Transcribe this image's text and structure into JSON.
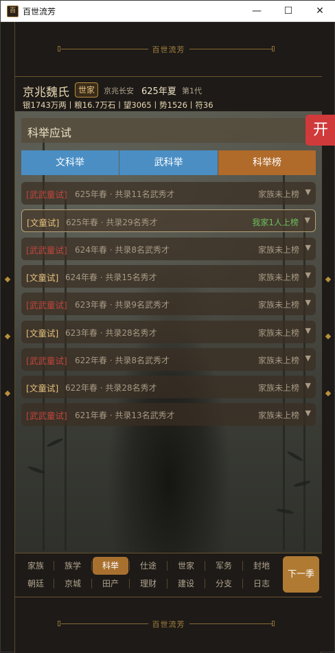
{
  "window": {
    "title": "百世流芳",
    "icon": "app-seal-icon",
    "icon_glyph": "百",
    "minimize": "—",
    "maximize": "☐",
    "close": "✕"
  },
  "banner": {
    "text": "百世流芳"
  },
  "family": {
    "name": "京兆魏氏",
    "badge": "世家",
    "place": "京兆长安",
    "year": "625年夏",
    "generation": "第1代",
    "stats": "银1743万两丨粮16.7万石丨望3065丨势1526丨符36"
  },
  "panel": {
    "title": "科举应试",
    "tabs": [
      "文科举",
      "武科举",
      "科举榜"
    ],
    "active_tab": 2,
    "results": [
      {
        "exam": "[武武童试]",
        "kind": "wu",
        "info": "625年春 · 共录11名武秀才",
        "status": "家族未上榜",
        "highlight": false
      },
      {
        "exam": "[文童试]",
        "kind": "wen",
        "info": "625年春 · 共录29名秀才",
        "status": "我家1人上榜",
        "highlight": true
      },
      {
        "exam": "[武武童试]",
        "kind": "wu",
        "info": "624年春 · 共录8名武秀才",
        "status": "家族未上榜",
        "highlight": false
      },
      {
        "exam": "[文童试]",
        "kind": "wen",
        "info": "624年春 · 共录15名秀才",
        "status": "家族未上榜",
        "highlight": false
      },
      {
        "exam": "[武武童试]",
        "kind": "wu",
        "info": "623年春 · 共录9名武秀才",
        "status": "家族未上榜",
        "highlight": false
      },
      {
        "exam": "[文童试]",
        "kind": "wen",
        "info": "623年春 · 共录28名秀才",
        "status": "家族未上榜",
        "highlight": false
      },
      {
        "exam": "[武武童试]",
        "kind": "wu",
        "info": "622年春 · 共录8名武秀才",
        "status": "家族未上榜",
        "highlight": false
      },
      {
        "exam": "[文童试]",
        "kind": "wen",
        "info": "622年春 · 共录28名秀才",
        "status": "家族未上榜",
        "highlight": false
      },
      {
        "exam": "[武武童试]",
        "kind": "wu",
        "info": "621年春 · 共录13名武秀才",
        "status": "家族未上榜",
        "highlight": false
      }
    ],
    "caret": "▼"
  },
  "open_button": "开",
  "nav": {
    "row1": [
      "家族",
      "族学",
      "科举",
      "仕途",
      "世家",
      "军务",
      "封地"
    ],
    "row2": [
      "朝廷",
      "京城",
      "田产",
      "理财",
      "建设",
      "分支",
      "日志"
    ],
    "active": "科举",
    "next": "下一季"
  },
  "colors": {
    "accent_gold": "#b8903c",
    "tab_blue": "#4a8ec4",
    "tab_active": "#b06a2a",
    "wu_red": "#c2463c",
    "wen_gold": "#e6c27d",
    "success_green": "#6cbf5c",
    "open_red": "#d03a3a"
  }
}
